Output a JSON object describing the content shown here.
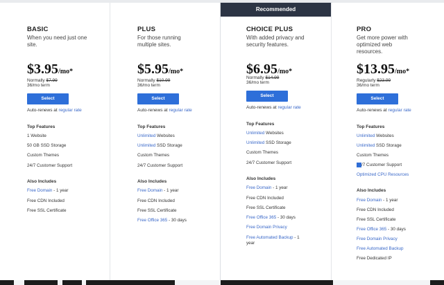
{
  "recommended_label": "Recommended",
  "plans": [
    {
      "name": "BASIC",
      "desc": "When you need just one site.",
      "price_main": "$3.95",
      "price_unit": "/mo*",
      "normally_prefix": "Normally",
      "normally_price": "$7.99",
      "term": "36/mo term",
      "button": "Select",
      "auto_prefix": "Auto-renews at",
      "auto_link": "regular rate",
      "top_title": "Top Features",
      "top_features": [
        {
          "link": "",
          "text": "1 Website"
        },
        {
          "link": "",
          "text": "50 GB SSD Storage"
        },
        {
          "link": "",
          "text": "Custom Themes"
        },
        {
          "link": "",
          "text": "24/7 Customer Support"
        }
      ],
      "also_title": "Also Includes",
      "also": [
        {
          "link": "Free Domain",
          "text": " - 1 year"
        },
        {
          "link": "",
          "text": "Free CDN Included"
        },
        {
          "link": "",
          "text": "Free SSL Certificate"
        }
      ]
    },
    {
      "name": "PLUS",
      "desc": "For those running multiple sites.",
      "price_main": "$5.95",
      "price_unit": "/mo*",
      "normally_prefix": "Normally",
      "normally_price": "$10.99",
      "term": "36/mo term",
      "button": "Select",
      "auto_prefix": "Auto-renews at",
      "auto_link": "regular rate",
      "top_title": "Top Features",
      "top_features": [
        {
          "link": "Unlimited",
          "text": " Websites"
        },
        {
          "link": "Unlimited",
          "text": " SSD Storage"
        },
        {
          "link": "",
          "text": "Custom Themes"
        },
        {
          "link": "",
          "text": "24/7 Customer Support"
        }
      ],
      "also_title": "Also Includes",
      "also": [
        {
          "link": "Free Domain",
          "text": " - 1 year"
        },
        {
          "link": "",
          "text": "Free CDN Included"
        },
        {
          "link": "",
          "text": "Free SSL Certificate"
        },
        {
          "link": "Free Office 365",
          "text": " - 30 days"
        }
      ]
    },
    {
      "name": "CHOICE PLUS",
      "desc": "With added privacy and security features.",
      "price_main": "$6.95",
      "price_unit": "/mo*",
      "normally_prefix": "Normally",
      "normally_price": "$14.99",
      "term": "36/mo term",
      "button": "Select",
      "auto_prefix": "Auto-renews at",
      "auto_link": "regular rate",
      "top_title": "Top Features",
      "top_features": [
        {
          "link": "Unlimited",
          "text": " Websites"
        },
        {
          "link": "Unlimited",
          "text": " SSD Storage"
        },
        {
          "link": "",
          "text": "Custom Themes"
        },
        {
          "link": "",
          "text": "24/7 Customer Support"
        }
      ],
      "also_title": "Also Includes",
      "also": [
        {
          "link": "Free Domain",
          "text": " - 1 year"
        },
        {
          "link": "",
          "text": "Free CDN Included"
        },
        {
          "link": "",
          "text": "Free SSL Certificate"
        },
        {
          "link": "Free Office 365",
          "text": " - 30 days"
        },
        {
          "link": "Free Domain Privacy",
          "text": ""
        },
        {
          "link": "Free Automated Backup",
          "text": " - 1"
        },
        {
          "link": "",
          "text": "year"
        }
      ]
    },
    {
      "name": "PRO",
      "desc": "Get more power with optimized web resources.",
      "price_main": "$13.95",
      "price_unit": "/mo*",
      "normally_prefix": "Regularly",
      "normally_price": "$23.99",
      "term": "36/mo term",
      "button": "Select",
      "auto_prefix": "Auto-renews at",
      "auto_link": "regular rate",
      "top_title": "Top Features",
      "top_features": [
        {
          "link": "Unlimited",
          "text": " Websites"
        },
        {
          "link": "Unlimited",
          "text": " SSD Storage"
        },
        {
          "link": "",
          "text": "Custom Themes"
        },
        {
          "link": "24",
          "text": "/7 Customer Support"
        },
        {
          "link": "Optimized CPU Resources",
          "text": ""
        }
      ],
      "also_title": "Also Includes",
      "also": [
        {
          "link": "Free Domain",
          "text": " - 1 year"
        },
        {
          "link": "",
          "text": "Free CDN Included"
        },
        {
          "link": "",
          "text": "Free SSL Certificate"
        },
        {
          "link": "Free Office 365",
          "text": " - 30 days"
        },
        {
          "link": "Free Domain Privacy",
          "text": ""
        },
        {
          "link": "Free Automated Backup",
          "text": ""
        },
        {
          "link": "",
          "text": "Free Dedicated IP"
        }
      ]
    }
  ],
  "colors": {
    "accent": "#2e6fd9",
    "link": "#3867c8",
    "banner": "#2c3444",
    "background": "#e9ebee"
  }
}
